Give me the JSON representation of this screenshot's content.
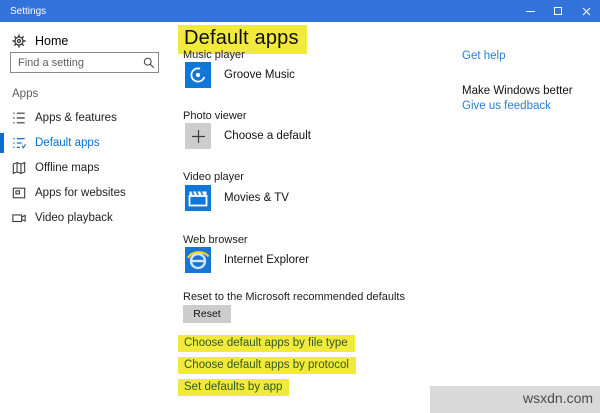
{
  "window": {
    "title": "Settings"
  },
  "sidebar": {
    "home_label": "Home",
    "search_placeholder": "Find a setting",
    "section_label": "Apps",
    "items": [
      {
        "label": "Apps & features",
        "selected": false
      },
      {
        "label": "Default apps",
        "selected": true
      },
      {
        "label": "Offline maps",
        "selected": false
      },
      {
        "label": "Apps for websites",
        "selected": false
      },
      {
        "label": "Video playback",
        "selected": false
      }
    ]
  },
  "main": {
    "title": "Default apps",
    "categories": [
      {
        "label": "Music player",
        "app": "Groove Music",
        "icon": "groove-music-icon"
      },
      {
        "label": "Photo viewer",
        "app": "Choose a default",
        "icon": "plus-icon"
      },
      {
        "label": "Video player",
        "app": "Movies & TV",
        "icon": "movies-tv-icon"
      },
      {
        "label": "Web browser",
        "app": "Internet Explorer",
        "icon": "internet-explorer-icon"
      }
    ],
    "reset": {
      "description": "Reset to the Microsoft recommended defaults",
      "button_label": "Reset"
    },
    "links": [
      "Choose default apps by file type",
      "Choose default apps by protocol",
      "Set defaults by app"
    ]
  },
  "help": {
    "get_help": "Get help",
    "make_windows_better": "Make Windows better",
    "give_feedback": "Give us feedback"
  },
  "watermark": "wsxdn.com",
  "colors": {
    "titlebar_blue": "#3372da",
    "accent_blue": "#0a6ed1",
    "tile_blue": "#0f77d7",
    "highlight_yellow": "#f1ea3d",
    "highlighted_link_text": "#33591d",
    "link_blue": "#2b7bd4"
  }
}
